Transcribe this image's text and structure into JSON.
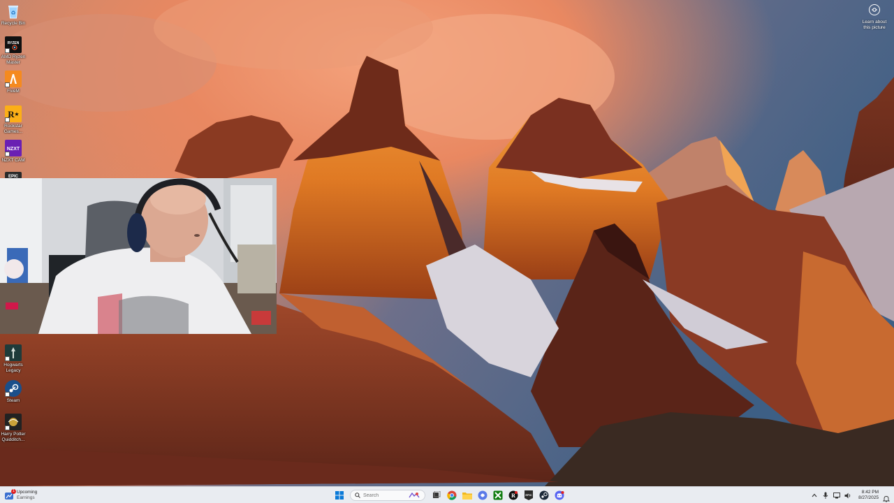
{
  "desktop": {
    "icons": [
      {
        "label": "Recycle Bin",
        "glyph": "♻",
        "color": "#7cc7ff"
      },
      {
        "label": "AMD Ryzen Master",
        "glyph": "R",
        "color": "#111111"
      },
      {
        "label": "FiveM",
        "glyph": "Λ",
        "color": "#f58a1f"
      },
      {
        "label": "Rockstar Games...",
        "glyph": "R★",
        "color": "#fcaf17"
      },
      {
        "label": "NZXT CAM",
        "glyph": "NZXT",
        "color": "#6a1fb3"
      },
      {
        "label": "EPIC",
        "glyph": "EPIC",
        "color": "#2a2a2a"
      },
      {
        "label": "Hogwarts Legacy",
        "glyph": "H",
        "color": "#1f3b3a"
      },
      {
        "label": "Steam",
        "glyph": "S",
        "color": "#1b4f8a"
      },
      {
        "label": "Harry Potter Quidditch...",
        "glyph": "Q",
        "color": "#222222"
      }
    ]
  },
  "learn_picture": {
    "label": "Learn about this picture",
    "icon": "camera-icon"
  },
  "taskbar": {
    "weather": {
      "line1": "Upcoming",
      "line2": "Earnings",
      "badge": "1"
    },
    "search_placeholder": "Search",
    "apps": [
      "start-icon",
      "task-view-icon",
      "chrome-icon",
      "file-explorer-icon",
      "chatgpt-icon",
      "xbox-icon",
      "rockstar-icon",
      "epic-games-icon",
      "steam-icon",
      "discord-icon"
    ],
    "tray_chevron": "^",
    "time": "8:42 PM",
    "date": "8/27/2025"
  },
  "colors": {
    "taskbar": "#e9ecf1",
    "start": "#0a7ad8",
    "chrome": "#db4437",
    "explorer": "#f2b91e",
    "discord": "#5865f2"
  }
}
